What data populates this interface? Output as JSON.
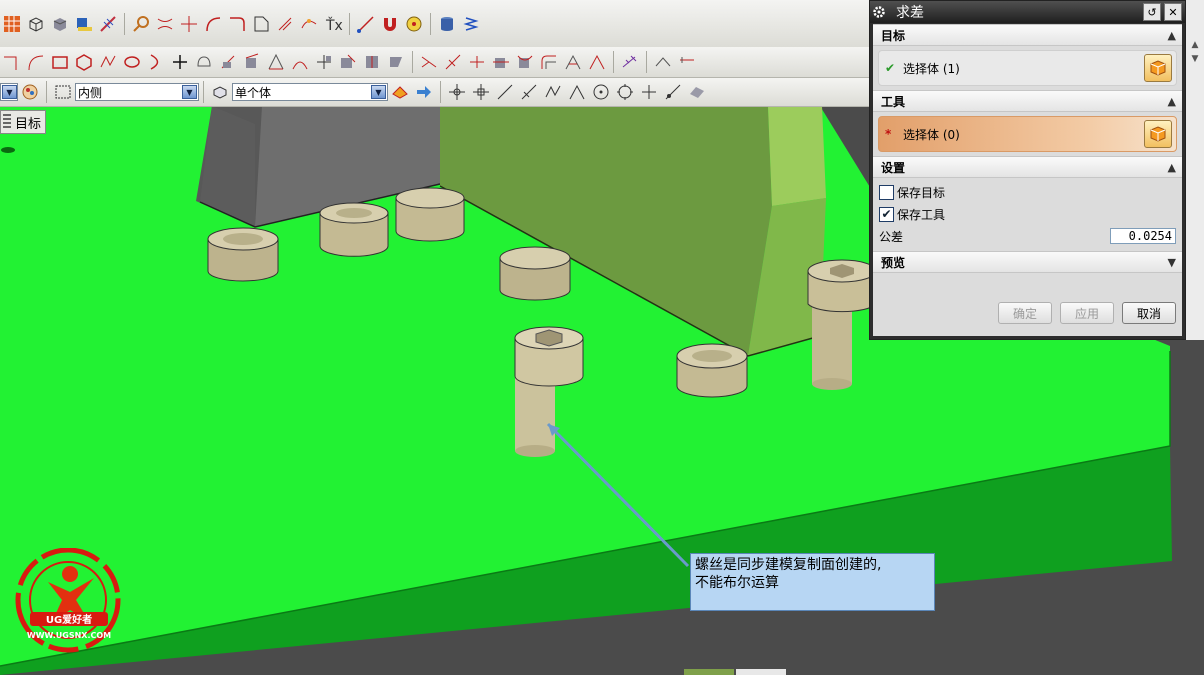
{
  "toolbar": {
    "filter_dropdown": "内侧",
    "selection_dropdown": "单个体"
  },
  "viewport": {
    "target_tab": "目标",
    "annotation": {
      "line1": "螺丝是同步建模复制面创建的,",
      "line2": "不能布尔运算"
    },
    "logo": {
      "brand": "UG爱好者",
      "url": "WWW.UGSNX.COM"
    }
  },
  "dialog": {
    "title": "求差",
    "target": {
      "header": "目标",
      "select_label": "选择体 (1)",
      "status": "selected"
    },
    "tool": {
      "header": "工具",
      "select_label": "选择体 (0)",
      "status": "required"
    },
    "settings": {
      "header": "设置",
      "keep_target_label": "保存目标",
      "keep_target": false,
      "keep_tool_label": "保存工具",
      "keep_tool": true,
      "tolerance_label": "公差",
      "tolerance_value": "0.0254"
    },
    "preview": {
      "header": "预览"
    },
    "buttons": {
      "ok": "确定",
      "apply": "应用",
      "cancel": "取消"
    }
  },
  "colors": {
    "plate_top": "#1ff231",
    "plate_side": "#0fa01f",
    "bolt": "#cfc7a0",
    "active_selection": "#e29f6a"
  }
}
